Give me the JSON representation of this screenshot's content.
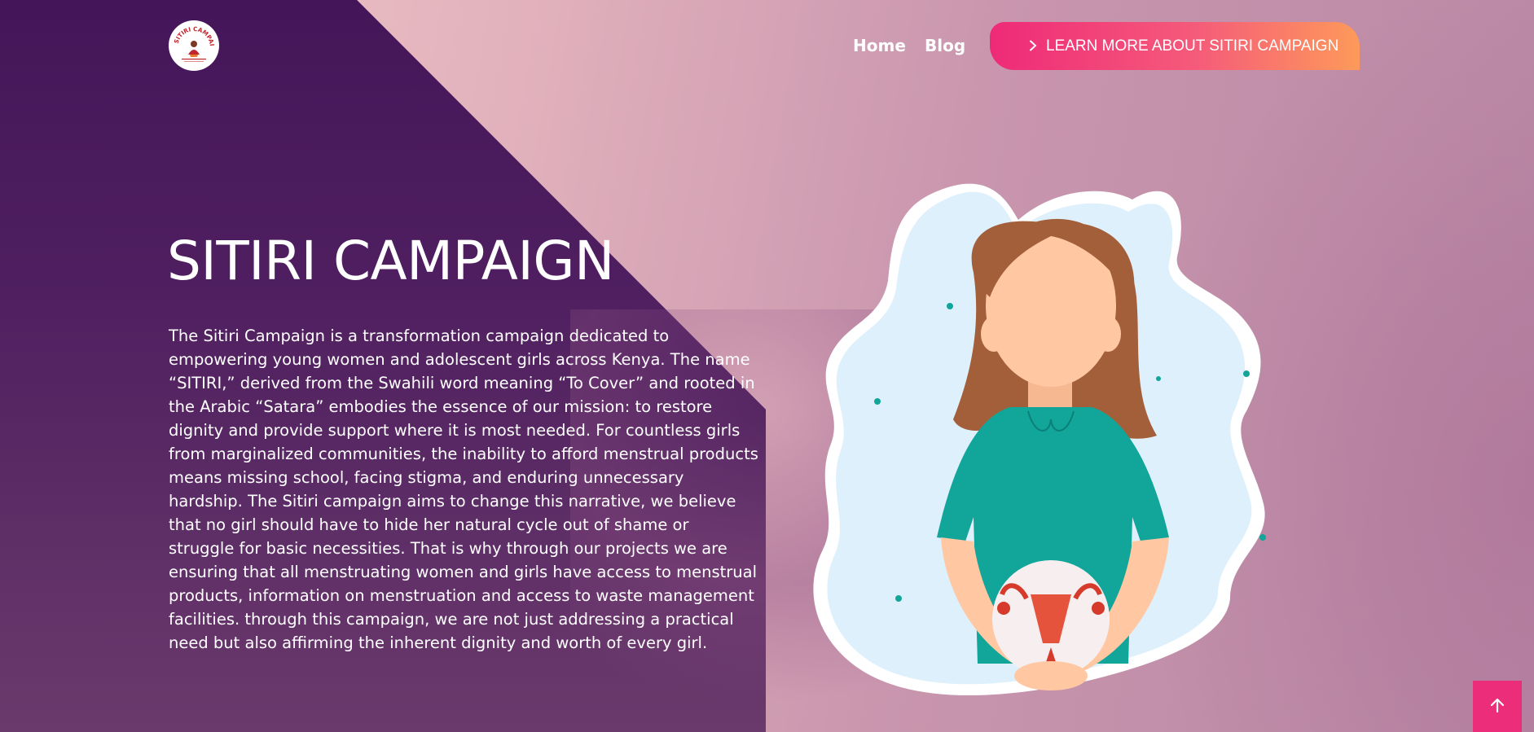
{
  "header": {
    "logo_alt": "SITIRI CAMPAIGN",
    "nav": [
      {
        "label": "Home"
      },
      {
        "label": "Blog"
      }
    ],
    "cta_label": "LEARN MORE ABOUT SITIRI CAMPAIGN"
  },
  "hero": {
    "title": "SITIRI CAMPAIGN",
    "description": "The Sitiri Campaign is a transformation campaign dedicated to empowering young women and adolescent girls across Kenya. The name “SITIRI,” derived from the Swahili word meaning “To Cover” and rooted in the Arabic “Satara” embodies the essence of our mission: to restore dignity and provide support where it is most needed. For countless girls from marginalized communities, the inability to afford menstrual products means missing school, facing stigma, and enduring unnecessary hardship. The Sitiri campaign aims to change this narrative, we believe that no girl should have to hide her natural cycle out of shame or struggle for basic necessities. That is why through our projects we are ensuring that all menstruating women and girls have access to menstrual products, information on menstruation and access to waste management facilities. through this campaign, we are not just addressing a practical need but also affirming the inherent dignity and worth of every girl."
  },
  "icons": {
    "cta": "chevron-right-icon",
    "scroll": "arrow-up-icon"
  },
  "colors": {
    "dark_purple": "#441659",
    "cta_start": "#ee2a78",
    "cta_end": "#fd9a5a",
    "scroll_button": "#ec2d7a",
    "shirt": "#12a59a"
  }
}
